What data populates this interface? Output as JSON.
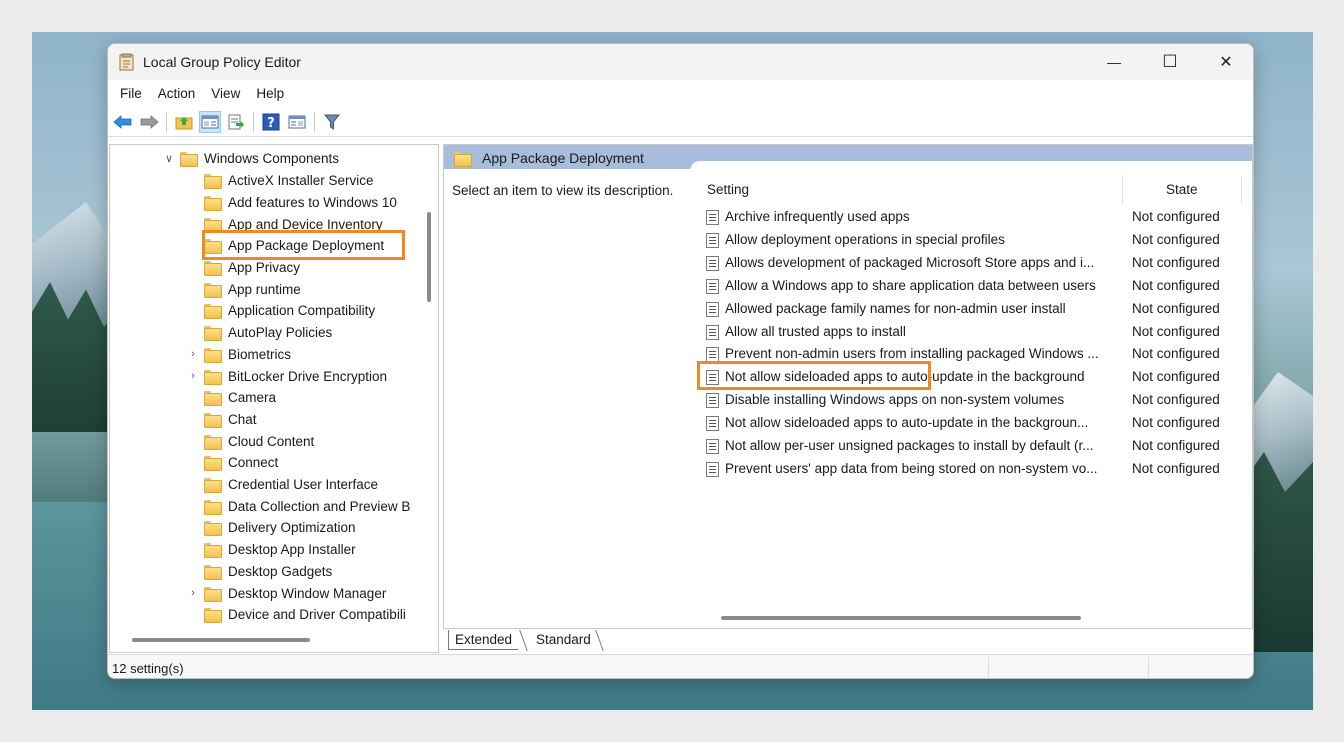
{
  "window": {
    "title": "Local Group Policy Editor",
    "controls": {
      "minimize": "—",
      "maximize": "☐",
      "close": "✕"
    }
  },
  "menu": [
    "File",
    "Action",
    "View",
    "Help"
  ],
  "toolbar": {
    "icons": [
      "back-arrow-icon",
      "forward-arrow-icon",
      "up-folder-icon",
      "show-hide-tree-icon",
      "export-list-icon",
      "help-icon",
      "properties-icon",
      "filter-icon"
    ]
  },
  "tree": {
    "root": {
      "label": "Windows Components",
      "expander": "∨"
    },
    "items": [
      {
        "label": "ActiveX Installer Service",
        "expander": ""
      },
      {
        "label": "Add features to Windows 10",
        "expander": ""
      },
      {
        "label": "App and Device Inventory",
        "expander": ""
      },
      {
        "label": "App Package Deployment",
        "expander": "",
        "selected": true
      },
      {
        "label": "App Privacy",
        "expander": ""
      },
      {
        "label": "App runtime",
        "expander": ""
      },
      {
        "label": "Application Compatibility",
        "expander": ""
      },
      {
        "label": "AutoPlay Policies",
        "expander": ""
      },
      {
        "label": "Biometrics",
        "expander": "›"
      },
      {
        "label": "BitLocker Drive Encryption",
        "expander": "›"
      },
      {
        "label": "Camera",
        "expander": ""
      },
      {
        "label": "Chat",
        "expander": ""
      },
      {
        "label": "Cloud Content",
        "expander": ""
      },
      {
        "label": "Connect",
        "expander": ""
      },
      {
        "label": "Credential User Interface",
        "expander": ""
      },
      {
        "label": "Data Collection and Preview B",
        "expander": ""
      },
      {
        "label": "Delivery Optimization",
        "expander": ""
      },
      {
        "label": "Desktop App Installer",
        "expander": ""
      },
      {
        "label": "Desktop Gadgets",
        "expander": ""
      },
      {
        "label": "Desktop Window Manager",
        "expander": "›"
      },
      {
        "label": "Device and Driver Compatibili",
        "expander": ""
      }
    ]
  },
  "panel": {
    "header": "App Package Deployment",
    "description": "Select an item to view its description.",
    "columns": {
      "setting": "Setting",
      "state": "State"
    },
    "settings": [
      {
        "name": "Archive infrequently used apps",
        "state": "Not configured"
      },
      {
        "name": "Allow deployment operations in special profiles",
        "state": "Not configured"
      },
      {
        "name": "Allows development of packaged Microsoft Store apps and i...",
        "state": "Not configured"
      },
      {
        "name": "Allow a Windows app to share application data between users",
        "state": "Not configured"
      },
      {
        "name": "Allowed package family names for non-admin user install",
        "state": "Not configured"
      },
      {
        "name": "Allow all trusted apps to install",
        "state": "Not configured",
        "highlighted": true
      },
      {
        "name": "Prevent non-admin users from installing packaged Windows ...",
        "state": "Not configured"
      },
      {
        "name": "Not allow sideloaded apps to auto-update in the background",
        "state": "Not configured"
      },
      {
        "name": "Disable installing Windows apps on non-system volumes",
        "state": "Not configured"
      },
      {
        "name": "Not allow sideloaded apps to auto-update in the backgroun...",
        "state": "Not configured"
      },
      {
        "name": "Not allow per-user unsigned packages to install by default (r...",
        "state": "Not configured"
      },
      {
        "name": "Prevent users' app data from being stored on non-system vo...",
        "state": "Not configured"
      }
    ]
  },
  "tabs": [
    "Extended",
    "Standard"
  ],
  "status": {
    "text": "12 setting(s)"
  },
  "colors": {
    "highlight": "#f08a1c",
    "header_band": "#a8bddc",
    "folder": "#f2c14e"
  }
}
